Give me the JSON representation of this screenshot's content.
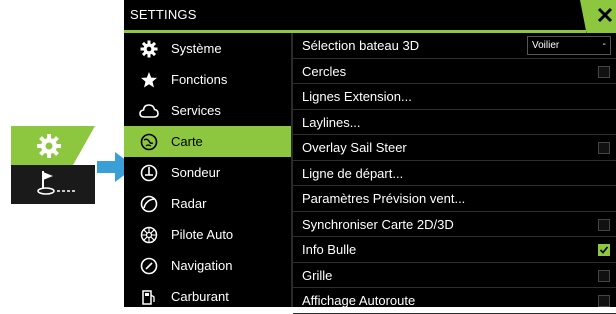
{
  "window": {
    "title": "SETTINGS"
  },
  "menu": {
    "items": [
      {
        "label": "Système",
        "icon": "gear-icon"
      },
      {
        "label": "Fonctions",
        "icon": "star-icon"
      },
      {
        "label": "Services",
        "icon": "cloud-icon"
      },
      {
        "label": "Carte",
        "icon": "chart-icon",
        "active": true
      },
      {
        "label": "Sondeur",
        "icon": "sonar-icon"
      },
      {
        "label": "Radar",
        "icon": "radar-icon"
      },
      {
        "label": "Pilote Auto",
        "icon": "autopilot-icon"
      },
      {
        "label": "Navigation",
        "icon": "navigation-icon"
      },
      {
        "label": "Carburant",
        "icon": "fuel-icon"
      }
    ]
  },
  "settings": {
    "rows": [
      {
        "label": "Sélection bateau 3D",
        "control": "dropdown",
        "value": "Voilier"
      },
      {
        "label": "Cercles",
        "control": "checkbox",
        "checked": false
      },
      {
        "label": "Lignes Extension...",
        "control": "none"
      },
      {
        "label": "Laylines...",
        "control": "none"
      },
      {
        "label": "Overlay Sail Steer",
        "control": "checkbox",
        "checked": false
      },
      {
        "label": "Ligne de départ...",
        "control": "none"
      },
      {
        "label": "Paramètres Prévision vent...",
        "control": "none"
      },
      {
        "label": "Synchroniser Carte 2D/3D",
        "control": "checkbox",
        "checked": false
      },
      {
        "label": "Info Bulle",
        "control": "checkbox",
        "checked": true
      },
      {
        "label": "Grille",
        "control": "checkbox",
        "checked": false
      },
      {
        "label": "Affichage Autoroute",
        "control": "checkbox",
        "checked": false
      }
    ]
  },
  "colors": {
    "accent": "#8dc63f",
    "arrow": "#3a9fd6",
    "background": "#000000"
  }
}
